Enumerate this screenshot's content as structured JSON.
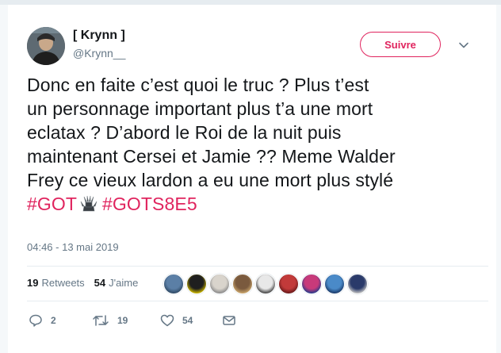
{
  "user": {
    "name": "[ Krynn ]",
    "handle": "@Krynn__",
    "avatar_colors": [
      "#3a3a3a",
      "#8c7a6b",
      "#d8c8b8"
    ]
  },
  "follow_button": {
    "label": "Suivre"
  },
  "tweet": {
    "lines": [
      "Donc en faite c’est quoi le truc ? Plus t’est",
      "un personnage important plus t’a une mort",
      "eclatax ? D’abord le Roi de la nuit puis",
      "maintenant Cersei et Jamie ?? Meme Walder",
      "Frey ce vieux lardon a eu une mort plus stylé"
    ],
    "hashtags": [
      "#GOT",
      "#GOTS8E5"
    ],
    "emoji_icon": "iron-throne-icon"
  },
  "timestamp": "04:46 - 13 mai 2019",
  "stats": {
    "retweets_count": "19",
    "retweets_label": "Retweets",
    "likes_count": "54",
    "likes_label": "J'aime"
  },
  "likers": [
    {
      "color": "#5b7fa6",
      "ring": "#2f4a66"
    },
    {
      "color": "#1f1f1f",
      "ring": "#c8b400"
    },
    {
      "color": "#d9d4cc",
      "ring": "#8a8a8a"
    },
    {
      "color": "#7a5a3e",
      "ring": "#c9a46b"
    },
    {
      "color": "#e8e8e8",
      "ring": "#444444"
    },
    {
      "color": "#c23a3a",
      "ring": "#6a1a1a"
    },
    {
      "color": "#c83a7a",
      "ring": "#2a3a8a"
    },
    {
      "color": "#4a8ac8",
      "ring": "#1a3a6a"
    },
    {
      "color": "#2a3a6a",
      "ring": "#c0c0c0"
    }
  ],
  "actions": {
    "reply_count": "2",
    "retweet_count": "19",
    "like_count": "54",
    "accent": "#657786"
  },
  "colors": {
    "hashtag": "#e0245e",
    "text": "#14171a",
    "muted": "#657786"
  }
}
